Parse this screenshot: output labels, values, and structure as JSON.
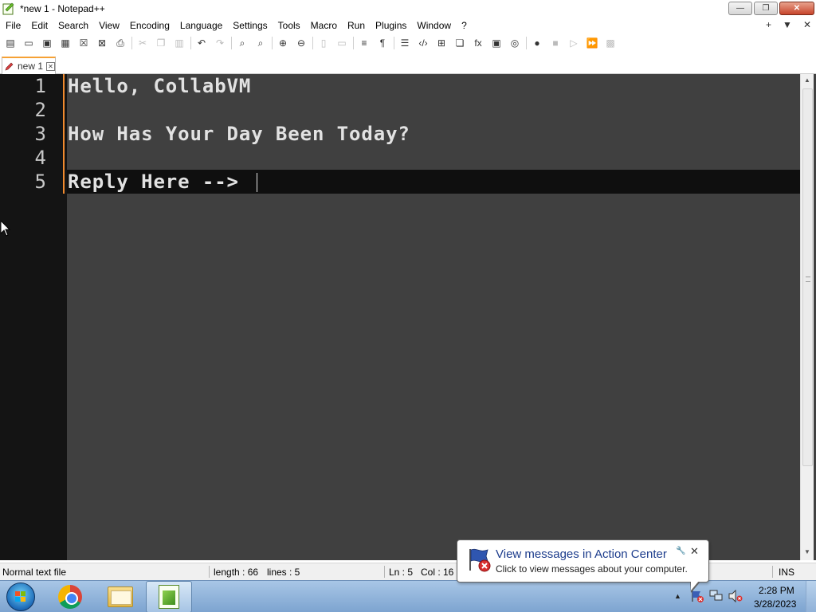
{
  "window": {
    "title": "*new 1 - Notepad++",
    "minimize_glyph": "—",
    "maximize_glyph": "❐",
    "close_glyph": "✕"
  },
  "menu": {
    "items": [
      "File",
      "Edit",
      "Search",
      "View",
      "Encoding",
      "Language",
      "Settings",
      "Tools",
      "Macro",
      "Run",
      "Plugins",
      "Window",
      "?"
    ],
    "right_icons": [
      "+",
      "▼",
      "✕"
    ]
  },
  "toolbar": {
    "buttons": [
      {
        "name": "new-file-icon",
        "glyph": "▤",
        "enabled": true
      },
      {
        "name": "open-file-icon",
        "glyph": "▭",
        "enabled": true
      },
      {
        "name": "save-icon",
        "glyph": "▣",
        "enabled": true
      },
      {
        "name": "save-all-icon",
        "glyph": "▦",
        "enabled": true
      },
      {
        "name": "close-icon",
        "glyph": "☒",
        "enabled": true
      },
      {
        "name": "close-all-icon",
        "glyph": "⊠",
        "enabled": true
      },
      {
        "name": "print-icon",
        "glyph": "⎙",
        "enabled": true
      },
      {
        "name": "cut-icon",
        "glyph": "✂",
        "enabled": false
      },
      {
        "name": "copy-icon",
        "glyph": "❐",
        "enabled": false
      },
      {
        "name": "paste-icon",
        "glyph": "▥",
        "enabled": false
      },
      {
        "name": "undo-icon",
        "glyph": "↶",
        "enabled": true
      },
      {
        "name": "redo-icon",
        "glyph": "↷",
        "enabled": false
      },
      {
        "name": "find-icon",
        "glyph": "⌕",
        "enabled": true
      },
      {
        "name": "replace-icon",
        "glyph": "⌕",
        "enabled": true
      },
      {
        "name": "zoom-in-icon",
        "glyph": "⊕",
        "enabled": true
      },
      {
        "name": "zoom-out-icon",
        "glyph": "⊖",
        "enabled": true
      },
      {
        "name": "sync-vertical-icon",
        "glyph": "▯",
        "enabled": false
      },
      {
        "name": "sync-horizontal-icon",
        "glyph": "▭",
        "enabled": false
      },
      {
        "name": "word-wrap-icon",
        "glyph": "≡",
        "enabled": true
      },
      {
        "name": "show-all-chars-icon",
        "glyph": "¶",
        "enabled": true
      },
      {
        "name": "indent-guide-icon",
        "glyph": "☰",
        "enabled": true
      },
      {
        "name": "language-tag-icon",
        "glyph": "‹/›",
        "enabled": true
      },
      {
        "name": "document-map-icon",
        "glyph": "⊞",
        "enabled": true
      },
      {
        "name": "document-list-icon",
        "glyph": "❏",
        "enabled": true
      },
      {
        "name": "function-list-icon",
        "glyph": "fx",
        "enabled": true
      },
      {
        "name": "monitoring-icon",
        "glyph": "▣",
        "enabled": true
      },
      {
        "name": "folder-workspace-icon",
        "glyph": "◎",
        "enabled": true
      },
      {
        "name": "record-macro-icon",
        "glyph": "●",
        "enabled": true
      },
      {
        "name": "stop-macro-icon",
        "glyph": "■",
        "enabled": false
      },
      {
        "name": "play-macro-icon",
        "glyph": "▷",
        "enabled": false
      },
      {
        "name": "run-macro-multiple-icon",
        "glyph": "⏩",
        "enabled": true
      },
      {
        "name": "save-macro-icon",
        "glyph": "▩",
        "enabled": false
      }
    ]
  },
  "tab": {
    "label": "new 1",
    "close_glyph": "✕"
  },
  "editor": {
    "lines": [
      {
        "number": "1",
        "text": "Hello, CollabVM"
      },
      {
        "number": "2",
        "text": ""
      },
      {
        "number": "3",
        "text": "How Has Your Day Been Today?"
      },
      {
        "number": "4",
        "text": ""
      },
      {
        "number": "5",
        "text": "Reply Here -->"
      }
    ],
    "current_line": 5
  },
  "statusbar": {
    "file_type": "Normal text file",
    "length": "length : 66",
    "lines": "lines : 5",
    "ln": "Ln : 5",
    "col": "Col : 16",
    "mode": "INS"
  },
  "notification": {
    "title": "View messages in Action Center",
    "text": "Click to view messages about your computer.",
    "close_glyph": "✕",
    "pin_glyph": "🔧"
  },
  "taskbar": {
    "apps": [
      "chrome",
      "windows-explorer",
      "notepad++"
    ],
    "tray_arrow": "▲",
    "time": "2:28 PM",
    "date": "3/28/2023"
  },
  "colors": {
    "editor_bg": "#404040",
    "gutter_bg": "#141414",
    "current_line_bg": "#0f0f0f",
    "change_marker": "#f08a2e",
    "text": "#e2e2e2"
  }
}
